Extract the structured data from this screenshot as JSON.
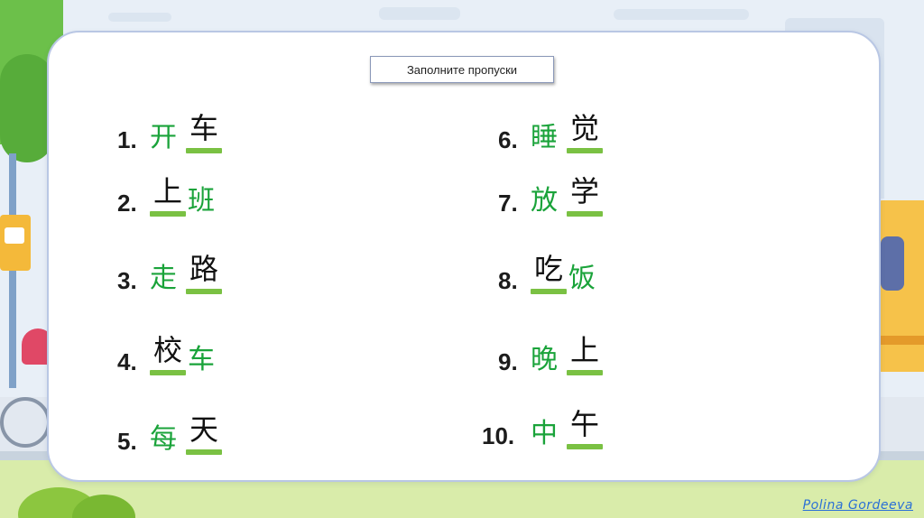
{
  "title": "Заполните пропуски",
  "items": [
    {
      "num": "1.",
      "given": "开",
      "answer": "车",
      "given_first": true
    },
    {
      "num": "2.",
      "given": "班",
      "answer": "上",
      "given_first": false
    },
    {
      "num": "3.",
      "given": "走",
      "answer": "路",
      "given_first": true
    },
    {
      "num": "4.",
      "given": "车",
      "answer": "校",
      "given_first": false
    },
    {
      "num": "5.",
      "given": "每",
      "answer": "天",
      "given_first": true
    },
    {
      "num": "6.",
      "given": "睡",
      "answer": "觉",
      "given_first": true
    },
    {
      "num": "7.",
      "given": "放",
      "answer": "学",
      "given_first": true
    },
    {
      "num": "8.",
      "given": "饭",
      "answer": "吃",
      "given_first": false
    },
    {
      "num": "9.",
      "given": "晚",
      "answer": "上",
      "given_first": true
    },
    {
      "num": "10.",
      "given": "中",
      "answer": "午",
      "given_first": true
    }
  ],
  "credit": "Polina Gordeeva",
  "colors": {
    "given": "#1aa33a",
    "answer": "#111111",
    "underline": "#7ac143",
    "card_border": "#b9c7e4"
  }
}
